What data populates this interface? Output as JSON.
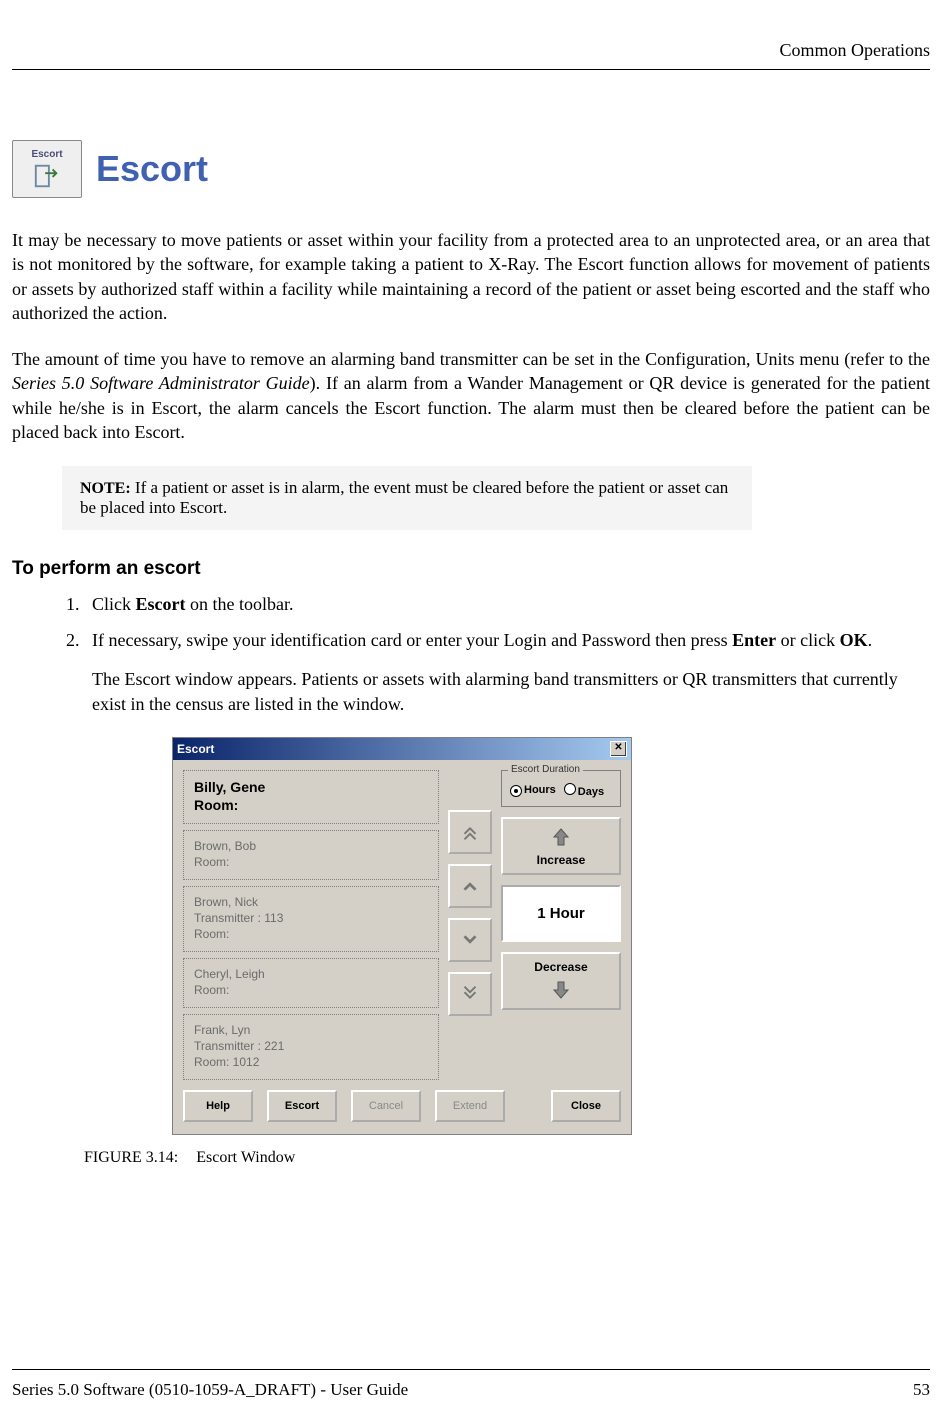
{
  "header": {
    "running_head": "Common Operations"
  },
  "section": {
    "icon_caption": "Escort",
    "title": "Escort",
    "para1": "It may be necessary to move patients or asset within your facility from a protected area to an unprotected area, or an area that is not monitored by the software, for example taking a patient to X-Ray. The Escort function allows for movement of patients or assets by authorized staff within a facility while maintaining a record of the patient or asset being escorted and the staff who authorized the action.",
    "para2_a": "The amount of time you have to remove an alarming band transmitter can be set in the Configuration, Units menu (refer to the ",
    "para2_italic": "Series 5.0 Software Administrator Guide",
    "para2_b": "). If an alarm from a Wander Management or QR device is generated for the patient while he/she is in Escort, the alarm cancels the Escort function. The alarm must then be cleared before the patient can be placed back into Escort.",
    "note_label": "NOTE:",
    "note_text": " If a patient or asset is in alarm, the event must be cleared before the patient or asset can be placed into Escort."
  },
  "procedure": {
    "subhead": "To perform an escort",
    "step1_a": "Click ",
    "step1_bold": "Escort",
    "step1_b": " on the toolbar.",
    "step2_a": "If necessary, swipe your identification card or enter your Login and Password then press ",
    "step2_bold1": "Enter",
    "step2_mid": " or click ",
    "step2_bold2": "OK",
    "step2_end": ".",
    "step2_follow": "The Escort window appears. Patients or assets with alarming band transmitters or QR transmitters that currently exist in the census are listed in the window."
  },
  "dialog": {
    "title": "Escort",
    "close_glyph": "✕",
    "patients": [
      {
        "name": "Billy, Gene",
        "room": "Room:",
        "tx": ""
      },
      {
        "name": "Brown, Bob",
        "room": "Room:",
        "tx": ""
      },
      {
        "name": "Brown, Nick",
        "room": "Room:",
        "tx": "Transmitter : 113"
      },
      {
        "name": "Cheryl, Leigh",
        "room": "Room:",
        "tx": ""
      },
      {
        "name": "Frank, Lyn",
        "room": "Room: 1012",
        "tx": "Transmitter : 221"
      }
    ],
    "duration_legend": "Escort Duration",
    "radio_hours": "Hours",
    "radio_days": "Days",
    "increase": "Increase",
    "display": "1 Hour",
    "decrease": "Decrease",
    "buttons": {
      "help": "Help",
      "escort": "Escort",
      "cancel": "Cancel",
      "extend": "Extend",
      "close": "Close"
    }
  },
  "figure": {
    "label": "FIGURE 3.14:",
    "caption": "Escort Window"
  },
  "footer": {
    "left": "Series 5.0 Software (0510-1059-A_DRAFT) - User Guide",
    "right": "53"
  }
}
